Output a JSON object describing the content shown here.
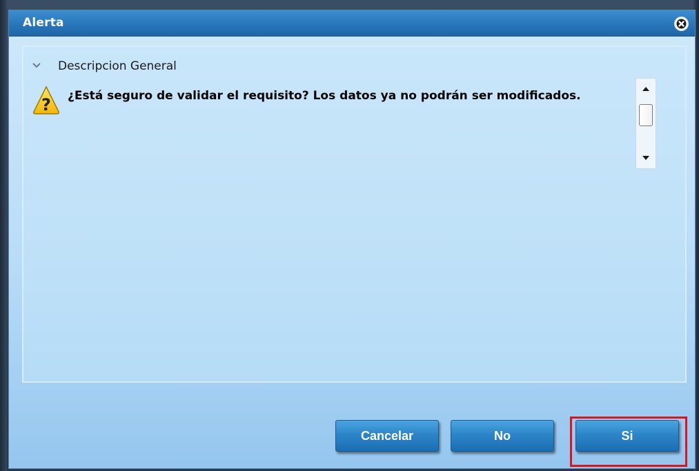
{
  "dialog": {
    "title": "Alerta",
    "close_icon": "close-icon"
  },
  "section": {
    "title": "Descripcion General",
    "expanded": true,
    "chevron_icon": "chevron-down-icon"
  },
  "message": {
    "icon": "warning-icon",
    "text": "¿Está seguro de validar el requisito? Los datos ya no podrán ser modificados."
  },
  "buttons": {
    "cancel_label": "Cancelar",
    "no_label": "No",
    "yes_label": "Si"
  },
  "colors": {
    "titlebar": "#2a78bd",
    "button": "#2d86c9",
    "highlight": "#e0131d",
    "warning_icon": "#f5c518"
  }
}
